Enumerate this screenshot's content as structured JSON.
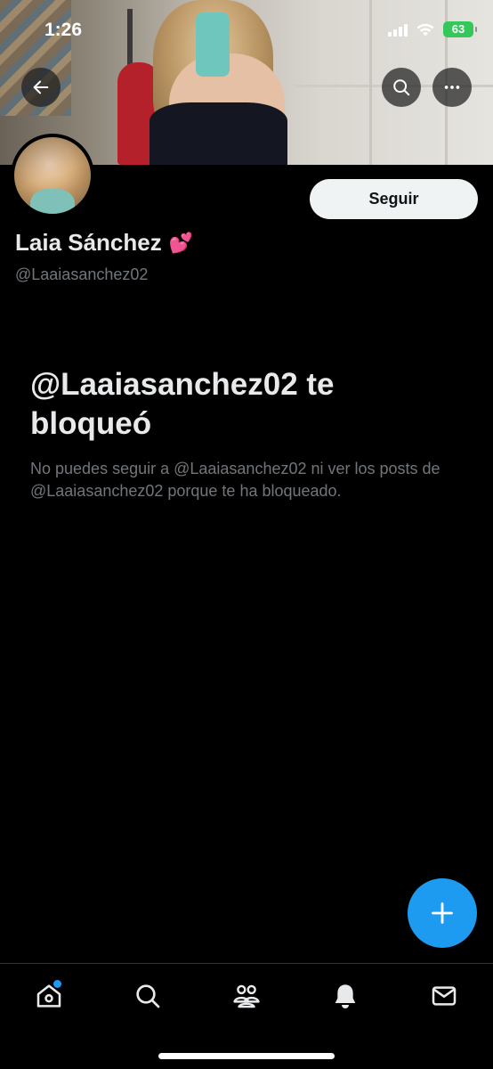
{
  "status_bar": {
    "time": "1:26",
    "battery": "63"
  },
  "header": {
    "back_icon": "arrow-left-icon",
    "search_icon": "search-icon",
    "more_icon": "more-horizontal-icon"
  },
  "profile": {
    "name": "Laia Sánchez",
    "emoji": "💕",
    "handle": "@Laaiasanchez02",
    "follow_label": "Seguir"
  },
  "blocked": {
    "title": "@Laaiasanchez02 te bloqueó",
    "description": "No puedes seguir a @Laaiasanchez02 ni ver los posts de @Laaiasanchez02 porque te ha bloqueado."
  },
  "fab": {
    "icon": "plus-icon"
  },
  "bottom_nav": {
    "items": [
      {
        "icon": "home-icon",
        "has_notification_dot": true
      },
      {
        "icon": "search-icon"
      },
      {
        "icon": "communities-icon"
      },
      {
        "icon": "bell-icon"
      },
      {
        "icon": "mail-icon"
      }
    ]
  },
  "colors": {
    "background": "#000000",
    "accent": "#1d9bf0",
    "text_primary": "#e7e9ea",
    "text_secondary": "#71767b",
    "battery": "#34c759"
  }
}
